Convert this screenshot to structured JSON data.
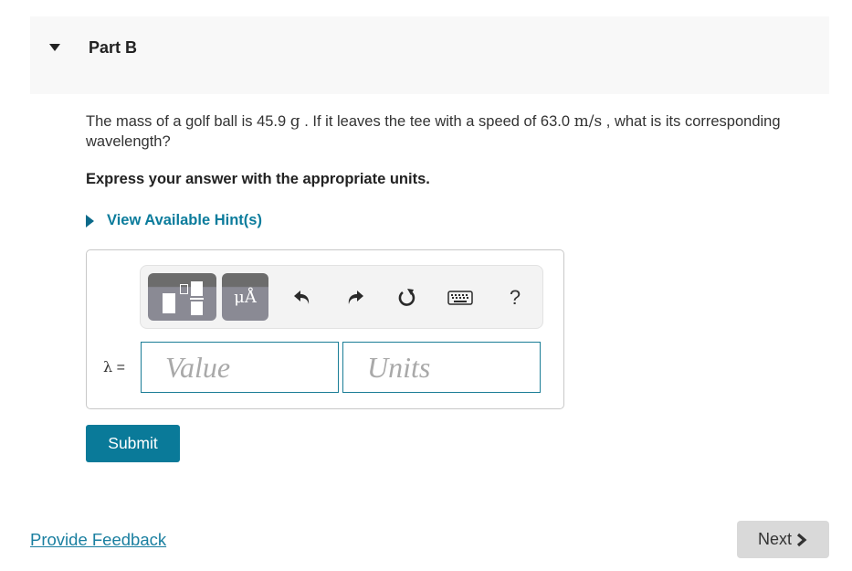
{
  "part": {
    "title": "Part B",
    "expanded": true
  },
  "question": {
    "text_1": "The mass of a golf ball is 45.9 ",
    "mass_unit": "g",
    "text_2": " . If it leaves the tee with a speed of 63.0 ",
    "speed_unit": "m/s",
    "text_3": " , what is its corresponding wavelength?"
  },
  "instruction": "Express your answer with the appropriate units.",
  "hint": {
    "label": "View Available Hint(s)"
  },
  "toolbar": {
    "templates_icon": "fraction-template-icon",
    "units_label": "μÅ",
    "undo_icon": "undo-icon",
    "redo_icon": "redo-icon",
    "reset_icon": "reset-icon",
    "keyboard_icon": "keyboard-icon",
    "help_label": "?"
  },
  "answer": {
    "variable_label": "λ",
    "equals": " =",
    "value_placeholder": "Value",
    "value": "",
    "units_placeholder": "Units",
    "units": ""
  },
  "buttons": {
    "submit": "Submit",
    "next": "Next",
    "next_icon": "chevron-right-icon"
  },
  "links": {
    "feedback": "Provide Feedback"
  },
  "colors": {
    "accent": "#0a7a99",
    "link": "#1a7fa0",
    "header_bg": "#f8f8f8",
    "next_bg": "#d9d9d9"
  }
}
